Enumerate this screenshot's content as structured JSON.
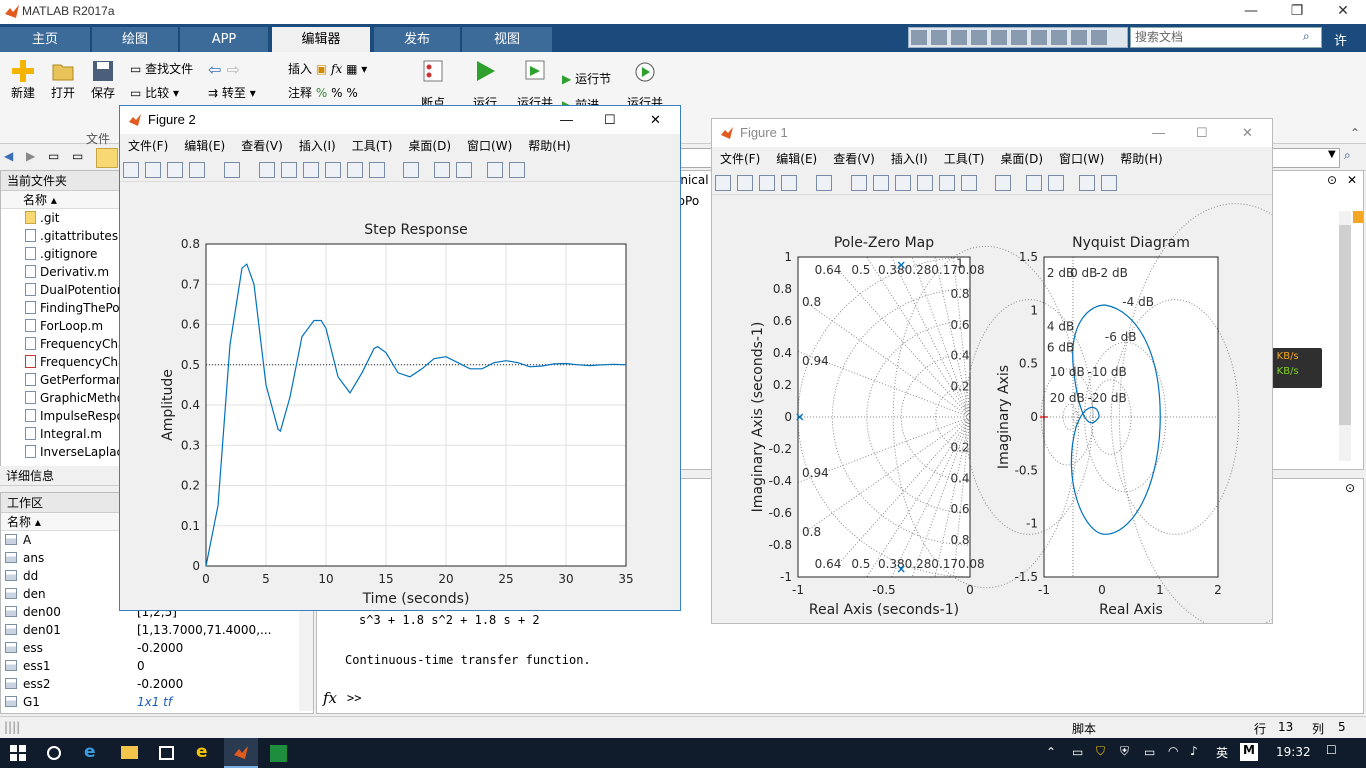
{
  "app": {
    "title": "MATLAB R2017a",
    "tabs": [
      "主页",
      "绘图",
      "APP",
      "编辑器",
      "发布",
      "视图"
    ],
    "active_tab": "编辑器",
    "search_placeholder": "搜索文档",
    "user_menu": "许"
  },
  "ribbon": {
    "new": "新建",
    "open": "打开",
    "save": "保存",
    "find_files": "查找文件",
    "compare": "比较",
    "goto": "转至",
    "insert": "插入",
    "comment": "注释",
    "breakpoints": "断点",
    "run": "运行",
    "run_advance": "运行并",
    "run_section": "运行节",
    "advance": "前进",
    "run_time": "运行并",
    "file_group": "文件"
  },
  "current_folder": {
    "title": "当前文件夹",
    "col_name": "名称",
    "files": [
      ".git",
      ".gitattributes",
      ".gitignore",
      "Derivativ.m",
      "DualPotention",
      "FindingThePo",
      "ForLoop.m",
      "FrequencyCha",
      "FrequencyCha",
      "GetPerforman",
      "GraphicMetho",
      "ImpulseRespo",
      "Integral.m",
      "InverseLaplac"
    ],
    "details": "详细信息"
  },
  "workspace": {
    "title": "工作区",
    "col_name": "名称",
    "vars": [
      {
        "name": "A",
        "value": ""
      },
      {
        "name": "ans",
        "value": ""
      },
      {
        "name": "dd",
        "value": ""
      },
      {
        "name": "den",
        "value": ""
      },
      {
        "name": "den00",
        "value": "[1,2,5]"
      },
      {
        "name": "den01",
        "value": "[1,13.7000,71.4000,..."
      },
      {
        "name": "ess",
        "value": "-0.2000"
      },
      {
        "name": "ess1",
        "value": "0"
      },
      {
        "name": "ess2",
        "value": "-0.2000"
      },
      {
        "name": "G1",
        "value": "1x1 tf"
      }
    ]
  },
  "command": {
    "line1": "s^3 + 1.8 s^2 + 1.8 s + 2",
    "line2": "Continuous-time transfer function.",
    "prompt": ">>",
    "fx": "fx"
  },
  "editor_partial": {
    "tab_text": "anical",
    "tab_text2": "roPo"
  },
  "status": {
    "mode": "脚本",
    "row_label": "行",
    "row": "13",
    "col_label": "列",
    "col": "5"
  },
  "net": {
    "up": "0.0 KB/s",
    "down": "0.0 KB/s",
    "up_color": "#f5a623",
    "down_color": "#7ed321"
  },
  "taskbar": {
    "time": "19:32",
    "ime": "英",
    "ime2": "M"
  },
  "figure2": {
    "title": "Figure 2",
    "menu": [
      "文件(F)",
      "编辑(E)",
      "查看(V)",
      "插入(I)",
      "工具(T)",
      "桌面(D)",
      "窗口(W)",
      "帮助(H)"
    ]
  },
  "figure1": {
    "title": "Figure 1",
    "menu": [
      "文件(F)",
      "编辑(E)",
      "查看(V)",
      "插入(I)",
      "工具(T)",
      "桌面(D)",
      "窗口(W)",
      "帮助(H)"
    ]
  },
  "chart_data": [
    {
      "type": "line",
      "title": "Step Response",
      "xlabel": "Time (seconds)",
      "ylabel": "Amplitude",
      "xlim": [
        0,
        35
      ],
      "ylim": [
        0,
        0.8
      ],
      "xticks": [
        "0",
        "5",
        "10",
        "15",
        "20",
        "25",
        "30",
        "35"
      ],
      "yticks": [
        "0",
        "0.1",
        "0.2",
        "0.3",
        "0.4",
        "0.5",
        "0.6",
        "0.7",
        "0.8"
      ],
      "grid": true,
      "steady_state": 0.5,
      "series": [
        {
          "x": [
            0,
            1,
            2,
            3,
            3.4,
            4,
            5,
            6,
            6.2,
            7,
            8,
            9,
            9.6,
            10,
            11,
            12,
            12,
            13,
            14,
            14.3,
            15,
            16,
            17,
            18,
            19,
            20,
            21,
            22,
            23,
            24,
            25,
            26,
            27,
            28,
            29,
            30,
            31,
            32,
            33,
            34,
            35
          ],
          "y": [
            0,
            0.15,
            0.55,
            0.74,
            0.75,
            0.7,
            0.45,
            0.34,
            0.335,
            0.42,
            0.57,
            0.61,
            0.61,
            0.59,
            0.47,
            0.43,
            0.43,
            0.48,
            0.54,
            0.545,
            0.53,
            0.48,
            0.47,
            0.49,
            0.515,
            0.52,
            0.505,
            0.49,
            0.49,
            0.505,
            0.51,
            0.505,
            0.495,
            0.497,
            0.502,
            0.503,
            0.5,
            0.498,
            0.5,
            0.501,
            0.5
          ]
        }
      ]
    },
    {
      "type": "scatter",
      "title": "Pole-Zero Map",
      "xlabel": "Real Axis (seconds-1)",
      "ylabel": "Imaginary Axis (seconds-1)",
      "xlim": [
        -1,
        0
      ],
      "ylim": [
        -1,
        1
      ],
      "xticks": [
        "-1",
        "-0.5",
        "0"
      ],
      "yticks": [
        "-1",
        "-0.8",
        "-0.6",
        "-0.4",
        "-0.2",
        "0",
        "0.2",
        "0.4",
        "0.6",
        "0.8",
        "1"
      ],
      "damping_labels": [
        "0.64",
        "0.5",
        "0.38",
        "0.28",
        "0.17",
        "0.08",
        "0.8",
        "0.94"
      ],
      "freq_labels": [
        "1",
        "0.8",
        "0.6",
        "0.4",
        "0.2"
      ],
      "poles": [
        {
          "re": -0.99,
          "im": 0
        },
        {
          "re": -0.4,
          "im": 0.95
        },
        {
          "re": -0.4,
          "im": -0.95
        }
      ]
    },
    {
      "type": "line",
      "title": "Nyquist Diagram",
      "xlabel": "Real Axis",
      "ylabel": "Imaginary Axis",
      "xlim": [
        -1,
        2
      ],
      "ylim": [
        -1.5,
        1.5
      ],
      "xticks": [
        "-1",
        "0",
        "1",
        "2"
      ],
      "yticks": [
        "-1.5",
        "-1",
        "-0.5",
        "0",
        "0.5",
        "1",
        "1.5"
      ],
      "db_labels": [
        "2 dB",
        "0 dB",
        "-2 dB",
        "-4 dB",
        "4 dB",
        "-6 dB",
        "6 dB",
        "10 dB",
        "-10 dB",
        "20 dB",
        "-20 dB"
      ]
    }
  ]
}
